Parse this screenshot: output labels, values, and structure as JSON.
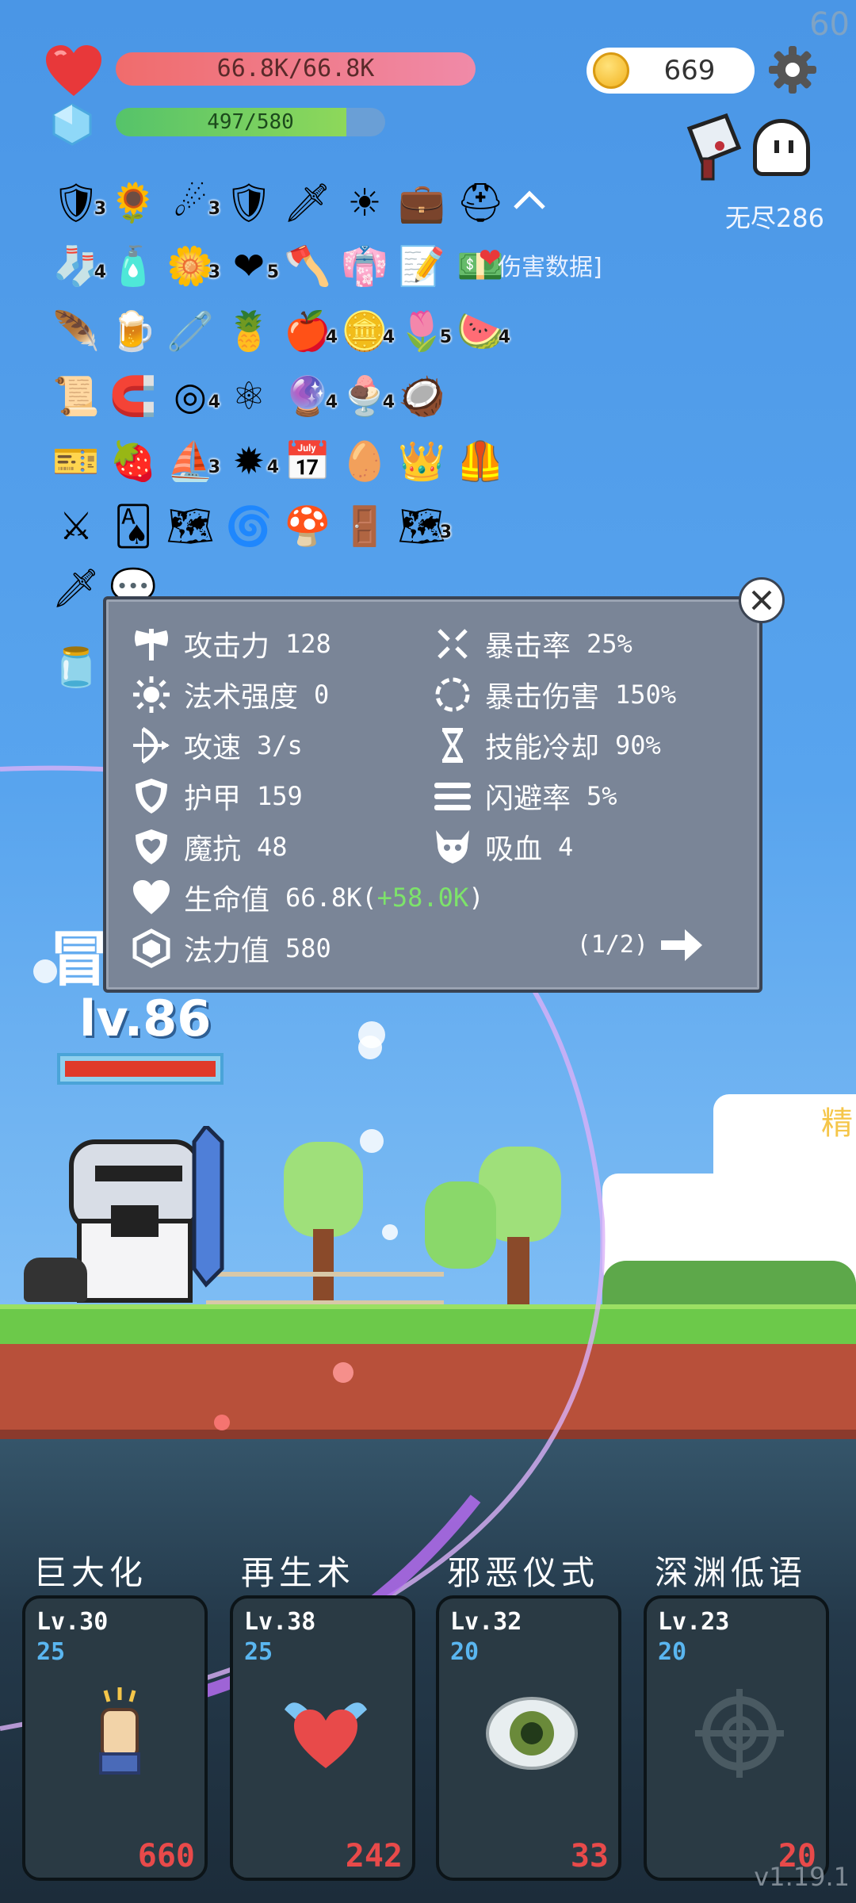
{
  "fps": "60",
  "hp": {
    "text": "66.8K/66.8K",
    "fraction": 1.0
  },
  "mp": {
    "text": "497/580",
    "fraction": 0.857
  },
  "gold": "669",
  "mode": "无尽286",
  "damage_link": "伤害数据]",
  "inventory": [
    {
      "icon": "round-shield-icon",
      "glyph": "🛡",
      "count": "3"
    },
    {
      "icon": "sunflower-icon",
      "glyph": "🌻",
      "count": ""
    },
    {
      "icon": "meteor-icon",
      "glyph": "☄",
      "count": "3"
    },
    {
      "icon": "red-shield-icon",
      "glyph": "🛡",
      "count": ""
    },
    {
      "icon": "sword-icon",
      "glyph": "🗡",
      "count": ""
    },
    {
      "icon": "sun-icon",
      "glyph": "☀",
      "count": ""
    },
    {
      "icon": "briefcase-icon",
      "glyph": "💼",
      "count": ""
    },
    {
      "icon": "knight-helmet-icon",
      "glyph": "⛑",
      "count": ""
    },
    {
      "icon": "red-sock-icon",
      "glyph": "🧦",
      "count": "4"
    },
    {
      "icon": "potion-bottle-icon",
      "glyph": "🧴",
      "count": ""
    },
    {
      "icon": "white-flower-icon",
      "glyph": "🌼",
      "count": "3"
    },
    {
      "icon": "heart-icon",
      "glyph": "❤",
      "count": "5"
    },
    {
      "icon": "battle-axe-icon",
      "glyph": "🪓",
      "count": ""
    },
    {
      "icon": "robe-icon",
      "glyph": "👘",
      "count": ""
    },
    {
      "icon": "map-pencil-icon",
      "glyph": "📝",
      "count": ""
    },
    {
      "icon": "money-icon",
      "glyph": "💵",
      "count": ""
    },
    {
      "icon": "feather-icon",
      "glyph": "🪶",
      "count": ""
    },
    {
      "icon": "beer-mug-icon",
      "glyph": "🍺",
      "count": ""
    },
    {
      "icon": "safety-pin-icon",
      "glyph": "🧷",
      "count": ""
    },
    {
      "icon": "pineapple-icon",
      "glyph": "🍍",
      "count": ""
    },
    {
      "icon": "apple-icon",
      "glyph": "🍎",
      "count": "4"
    },
    {
      "icon": "coins-icon",
      "glyph": "🪙",
      "count": "4"
    },
    {
      "icon": "potted-flower-icon",
      "glyph": "🌷",
      "count": "5"
    },
    {
      "icon": "watermelon-icon",
      "glyph": "🍉",
      "count": "4"
    },
    {
      "icon": "scroll-icon",
      "glyph": "📜",
      "count": ""
    },
    {
      "icon": "magnet-icon",
      "glyph": "🧲",
      "count": ""
    },
    {
      "icon": "target-shield-icon",
      "glyph": "◎",
      "count": "4"
    },
    {
      "icon": "molecule-icon",
      "glyph": "⚛",
      "count": ""
    },
    {
      "icon": "blue-orb-icon",
      "glyph": "🔮",
      "count": "4"
    },
    {
      "icon": "sundae-icon",
      "glyph": "🍨",
      "count": "4"
    },
    {
      "icon": "coconut-icon",
      "glyph": "🥥",
      "count": ""
    },
    {
      "icon": "star-card-icon",
      "glyph": "🎫",
      "count": ""
    },
    {
      "icon": "strawberry-icon",
      "glyph": "🍓",
      "count": ""
    },
    {
      "icon": "pirate-ship-icon",
      "glyph": "⛵",
      "count": "3"
    },
    {
      "icon": "spiked-mace-icon",
      "glyph": "✹",
      "count": "4"
    },
    {
      "icon": "calendar-heart-icon",
      "glyph": "📅",
      "count": ""
    },
    {
      "icon": "melon-icon",
      "glyph": "🥚",
      "count": ""
    },
    {
      "icon": "crown-icon",
      "glyph": "👑",
      "count": ""
    },
    {
      "icon": "armor-icon",
      "glyph": "🦺",
      "count": ""
    },
    {
      "icon": "crossed-swords-icon",
      "glyph": "⚔",
      "count": ""
    },
    {
      "icon": "playing-cards-icon",
      "glyph": "🂡",
      "count": ""
    },
    {
      "icon": "treasure-map-icon",
      "glyph": "🗺",
      "count": ""
    },
    {
      "icon": "spiral-icon",
      "glyph": "🌀",
      "count": ""
    },
    {
      "icon": "mushroom-icon",
      "glyph": "🍄",
      "count": ""
    },
    {
      "icon": "door-icon",
      "glyph": "🚪",
      "count": ""
    },
    {
      "icon": "folded-map-icon",
      "glyph": "🗺",
      "count": "3"
    },
    {
      "icon": "greatsword-icon",
      "glyph": "🗡",
      "count": ""
    },
    {
      "icon": "speech-bubble-icon",
      "glyph": "💬",
      "count": ""
    },
    {
      "icon": "jar-icon",
      "glyph": "🫙",
      "count": ""
    },
    {
      "icon": "pill-icon",
      "glyph": "💊",
      "count": ""
    },
    {
      "icon": "glowing-gem-icon",
      "glyph": "💠",
      "count": ""
    }
  ],
  "stats": {
    "left": [
      {
        "icon": "axe-icon",
        "label": "攻击力",
        "value": "128"
      },
      {
        "icon": "sun-icon",
        "label": "法术强度",
        "value": "0"
      },
      {
        "icon": "bow-icon",
        "label": "攻速",
        "value": "3/s"
      },
      {
        "icon": "shield-icon",
        "label": "护甲",
        "value": "159"
      },
      {
        "icon": "magic-shield-icon",
        "label": "魔抗",
        "value": "48"
      }
    ],
    "right": [
      {
        "icon": "crit-rate-icon",
        "label": "暴击率",
        "value": "25%"
      },
      {
        "icon": "crit-damage-icon",
        "label": "暴击伤害",
        "value": "150%"
      },
      {
        "icon": "hourglass-icon",
        "label": "技能冷却",
        "value": "90%"
      },
      {
        "icon": "dodge-icon",
        "label": "闪避率",
        "value": "5%"
      },
      {
        "icon": "skull-icon",
        "label": "吸血",
        "value": "4"
      }
    ],
    "hp": {
      "label": "生命值",
      "value": "66.8K",
      "open": "(",
      "bonus": "+58.0K",
      "close": ")"
    },
    "mp": {
      "label": "法力值",
      "value": "580"
    },
    "page": "(1/2)"
  },
  "hero": {
    "level": "lv.86",
    "banner_char": "冒"
  },
  "elite_char": "精",
  "skills": [
    {
      "name": "巨大化",
      "level": "Lv.30",
      "cost": "25",
      "count": "660",
      "icon": "fist-icon"
    },
    {
      "name": "再生术",
      "level": "Lv.38",
      "cost": "25",
      "count": "242",
      "icon": "winged-heart-icon"
    },
    {
      "name": "邪恶仪式",
      "level": "Lv.32",
      "cost": "20",
      "count": "33",
      "icon": "eye-icon"
    },
    {
      "name": "深渊低语",
      "level": "Lv.23",
      "cost": "20",
      "count": "20",
      "icon": "crosshair-icon"
    }
  ],
  "version": "v1.19.1",
  "colors": {
    "hp": "#f06c6c",
    "mp": "#55c36a",
    "bonus": "#7de36a",
    "skill_count": "#e84a4a",
    "skill_cost": "#5ab6f0"
  }
}
